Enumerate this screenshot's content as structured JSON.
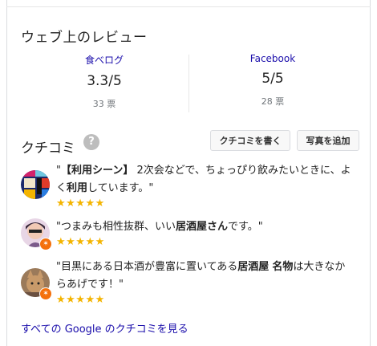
{
  "web_reviews": {
    "title": "ウェブ上のレビュー",
    "sources": [
      {
        "name": "食べログ",
        "score": "3.3/5",
        "votes": "33 票"
      },
      {
        "name": "Facebook",
        "score": "5/5",
        "votes": "28 票"
      }
    ]
  },
  "kuchikomi": {
    "title": "クチコミ",
    "help_icon": "?",
    "write_button": "クチコミを書く",
    "photo_button": "写真を追加",
    "reviews": [
      {
        "prefix": "\"",
        "bold1": "【利用シーン】",
        "mid1": " 2次会などで、ちょっぴり飲みたいときに、よく",
        "bold2": "利用",
        "suffix": "しています。\"",
        "stars": "★★★★★",
        "rating": 5
      },
      {
        "prefix": "\"つまみも相性抜群、いい",
        "bold1": "居酒屋さん",
        "suffix": "です。\"",
        "stars": "★★★★★",
        "rating": 5
      },
      {
        "prefix": "\"目黒にある日本酒が豊富に置いてある",
        "bold1": "居酒屋",
        "mid1": " ",
        "bold2": "名物",
        "suffix": "は大きなからあげです！\"",
        "stars": "★★★★★",
        "rating": 5
      }
    ],
    "see_all": "すべての Google のクチコミを見る"
  },
  "colors": {
    "link": "#1a0dab",
    "star": "#f4b400",
    "badge": "#f4700b"
  }
}
